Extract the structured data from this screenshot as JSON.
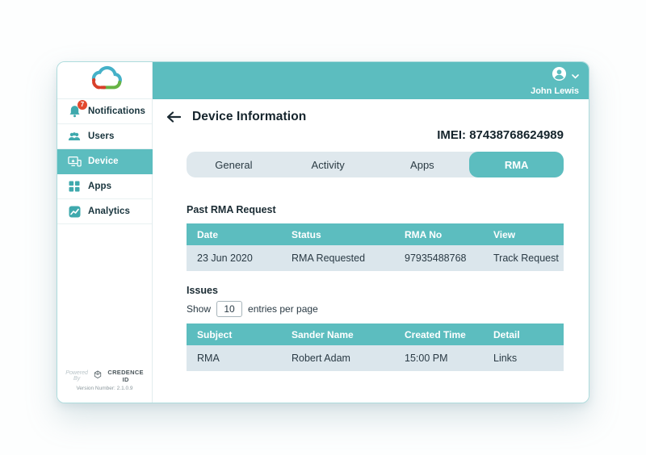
{
  "colors": {
    "teal": "#5cbdbf",
    "row_bg": "#dbe6ec",
    "link_blue": "#3fafe8",
    "badge_red": "#e2492e"
  },
  "topbar": {
    "user_name": "John Lewis"
  },
  "sidebar": {
    "items": [
      {
        "label": "Notifications",
        "icon": "bell-icon",
        "badge": "7"
      },
      {
        "label": "Users",
        "icon": "users-icon"
      },
      {
        "label": "Device",
        "icon": "device-icon",
        "selected": true
      },
      {
        "label": "Apps",
        "icon": "apps-grid-icon"
      },
      {
        "label": "Analytics",
        "icon": "analytics-icon"
      }
    ],
    "footer": {
      "powered_by": "Powered By",
      "brand": "Credence ID",
      "version": "Version Number: 2.1.0.9"
    }
  },
  "main": {
    "title": "Device Information",
    "imei": "IMEI: 87438768624989",
    "tabs": [
      {
        "label": "General"
      },
      {
        "label": "Activity"
      },
      {
        "label": "Apps"
      },
      {
        "label": "RMA",
        "selected": true
      }
    ],
    "past_rma": {
      "heading": "Past RMA Request",
      "columns": [
        "Date",
        "Status",
        "RMA No",
        "View"
      ],
      "rows": [
        {
          "date": "23 Jun 2020",
          "status": "RMA Requested",
          "rma_no": "97935488768",
          "view": "Track Request"
        }
      ]
    },
    "issues": {
      "heading": "Issues",
      "show_label": "Show",
      "entries_value": "10",
      "entries_suffix": "entries per page",
      "columns": [
        "Subject",
        "Sander Name",
        "Created Time",
        "Detail"
      ],
      "rows": [
        {
          "subject": "RMA",
          "sender": "Robert Adam",
          "created": "15:00 PM",
          "detail": "Links"
        }
      ]
    }
  }
}
